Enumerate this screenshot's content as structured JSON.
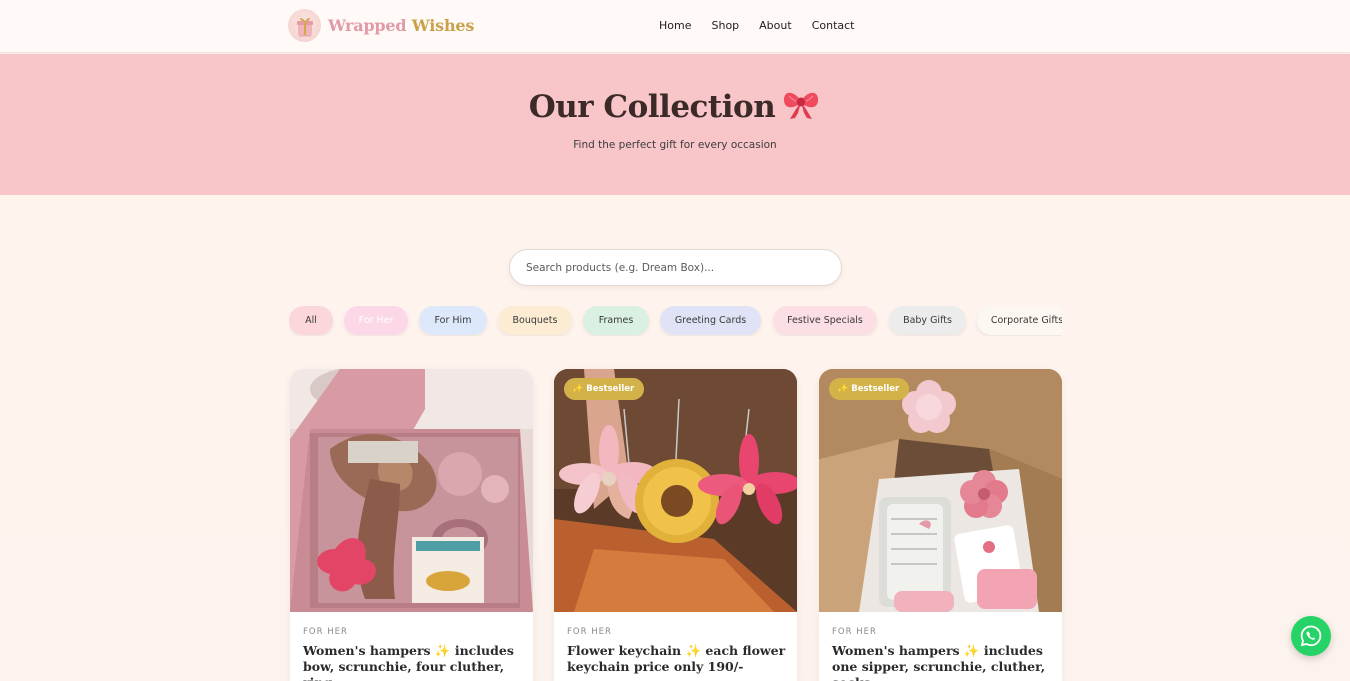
{
  "header": {
    "brand_part1": "Wrapped",
    "brand_part2": "Wishes",
    "logo_icon": "gift-box-logo",
    "nav": [
      {
        "label": "Home"
      },
      {
        "label": "Shop"
      },
      {
        "label": "About"
      },
      {
        "label": "Contact"
      }
    ]
  },
  "hero": {
    "title": "Our Collection",
    "title_icon": "ribbon-bow-icon",
    "subtitle": "Find the perfect gift for every occasion",
    "background": "#f8c5c9"
  },
  "search": {
    "placeholder": "Search products (e.g. Dream Box)..."
  },
  "categories": [
    {
      "label": "All",
      "color": "#fbd6da",
      "active": false
    },
    {
      "label": "For Her",
      "color": "#fcd7e8",
      "active": true
    },
    {
      "label": "For Him",
      "color": "#dde9fb",
      "active": false
    },
    {
      "label": "Bouquets",
      "color": "#fdecd4",
      "active": false
    },
    {
      "label": "Frames",
      "color": "#d9f0e3",
      "active": false
    },
    {
      "label": "Greeting Cards",
      "color": "#e0e2f6",
      "active": false
    },
    {
      "label": "Festive Specials",
      "color": "#fbdfe4",
      "active": false
    },
    {
      "label": "Baby Gifts",
      "color": "#ececec",
      "active": false
    },
    {
      "label": "Corporate Gifts",
      "color": "#fdf7f2",
      "active": false
    }
  ],
  "products": [
    {
      "category": "FOR HER",
      "title": "Women's hampers ✨ includes bow, scrunchie, four cluther, ring",
      "badge": ""
    },
    {
      "category": "FOR HER",
      "title": "Flower keychain ✨ each flower keychain price only 190/-",
      "badge": "Bestseller"
    },
    {
      "category": "FOR HER",
      "title": "Women's hampers ✨ includes one sipper, scrunchie, cluther, socks",
      "badge": "Bestseller"
    }
  ],
  "badge_icon": "sparkle-icon",
  "whatsapp": {
    "icon": "whatsapp-icon",
    "color": "#25d366"
  },
  "colors": {
    "brand_pink": "#e29aa6",
    "brand_gold": "#c8a14a",
    "badge_gold": "#d4b24a"
  }
}
